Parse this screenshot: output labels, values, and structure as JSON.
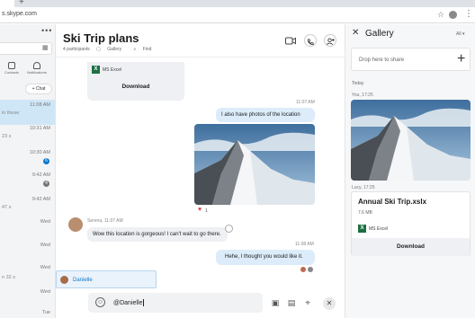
{
  "browser": {
    "url": "s.skype.com",
    "new_tab": "+",
    "star": "☆",
    "menu": "⋮"
  },
  "sidebar": {
    "more": "•••",
    "nav": [
      {
        "label": "Contacts",
        "icon": "contacts-icon"
      },
      {
        "label": "Notifications",
        "icon": "bell-icon"
      }
    ],
    "chat_button": "+ Chat",
    "rows": [
      {
        "time": "11:08 AM",
        "snippet": "in these",
        "active": true
      },
      {
        "time": "10:31 AM",
        "snippet": "23 s",
        "active": false
      },
      {
        "time": "10:30 AM",
        "snippet": "",
        "badge": "6",
        "badge_color": "#0d76c9"
      },
      {
        "time": "9:42 AM",
        "snippet": "",
        "badge": "4",
        "badge_color": "#777777"
      },
      {
        "time": "9:42 AM",
        "snippet": "47 s",
        "active": false
      },
      {
        "time": "Wed",
        "snippet": "",
        "active": false
      },
      {
        "time": "Wed",
        "snippet": "",
        "active": false
      },
      {
        "time": "Wed",
        "snippet": "n 32 s",
        "active": false
      },
      {
        "time": "Wed",
        "snippet": "",
        "active": false
      },
      {
        "time": "Tue",
        "snippet": "",
        "active": false
      }
    ]
  },
  "chat": {
    "title": "Ski Trip plans",
    "participants": "4 participants",
    "gallery_link": "Gallery",
    "find_link": "Find",
    "file_card": {
      "app": "MS Excel",
      "download": "Download"
    },
    "messages": [
      {
        "time": "11:07 AM",
        "text": "I also have photos of the location",
        "direction": "out"
      },
      {
        "reaction": "1"
      },
      {
        "sender": "Serena, 11:07 AM",
        "text": "Wow this location is gorgeous! I can't wait to go there.",
        "direction": "in"
      },
      {
        "time": "11:08 AM",
        "text": "Hehe, I thought you would like it.",
        "direction": "out"
      }
    ],
    "mention_suggestion": "Danielle",
    "composer_value": "@Danielle"
  },
  "gallery": {
    "title": "Gallery",
    "filter": "All",
    "drop_placeholder": "Drop here to share",
    "section": "Today",
    "photo_meta": "You, 17:25",
    "file_meta": "Lucy, 17:25",
    "file": {
      "name": "Annual Ski Trip.xslx",
      "size": "7.6 MB",
      "app": "MS Excel",
      "download": "Download"
    }
  },
  "colors": {
    "accent": "#0d76c9",
    "out_bubble": "#dcecfa",
    "in_bubble": "#eef0f3",
    "excel": "#1d6f42"
  }
}
